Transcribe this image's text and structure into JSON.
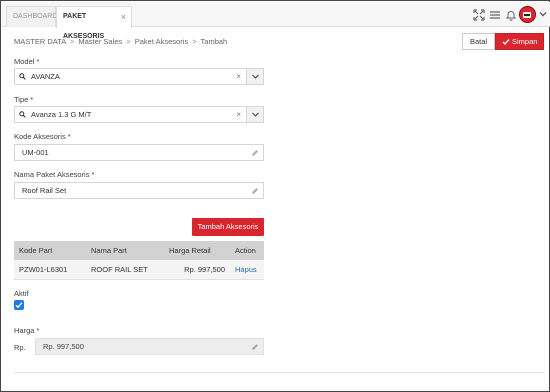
{
  "tabs": [
    {
      "label": "DASHBOARD",
      "active": false
    },
    {
      "label": "PAKET AKSESORIS",
      "active": true,
      "close": "×"
    }
  ],
  "toolbar_icons": [
    "expand-icon",
    "menu-icon",
    "bell-icon",
    "user-avatar",
    "chevron-down-icon"
  ],
  "breadcrumb": [
    "MASTER DATA",
    "Master Sales",
    "Paket Aksesoris",
    "Tambah"
  ],
  "breadcrumb_sep": ">",
  "actions": {
    "batal": "Batal",
    "simpan": "Simpan"
  },
  "form": {
    "model": {
      "label": "Model *",
      "value": "AVANZA",
      "clear": "×"
    },
    "tipe": {
      "label": "Tipe *",
      "value": "Avanza 1.3 G M/T",
      "clear": "×"
    },
    "kode_aksesoris": {
      "label": "Kode Aksesoris *",
      "value": "UM-001"
    },
    "nama_paket": {
      "label": "Nama Paket Aksesoris *",
      "value": "Roof Rail Set"
    },
    "add_button": "Tambah Aksesoris",
    "aktif": {
      "label": "Aktif",
      "checked": true
    },
    "harga": {
      "label": "Harga *",
      "prefix": "Rp.",
      "value": "Rp. 997,500"
    }
  },
  "table": {
    "headers": [
      "Kode Part",
      "Nama Part",
      "Harga Retail",
      "Action"
    ],
    "rows": [
      {
        "kode": "PZW01-L6301",
        "nama": "ROOF RAIL SET",
        "harga": "Rp. 997,500",
        "action": "Hapus"
      }
    ]
  },
  "colors": {
    "accent": "#d9262e",
    "link": "#2a6db5",
    "checkbox": "#1e7be6"
  }
}
